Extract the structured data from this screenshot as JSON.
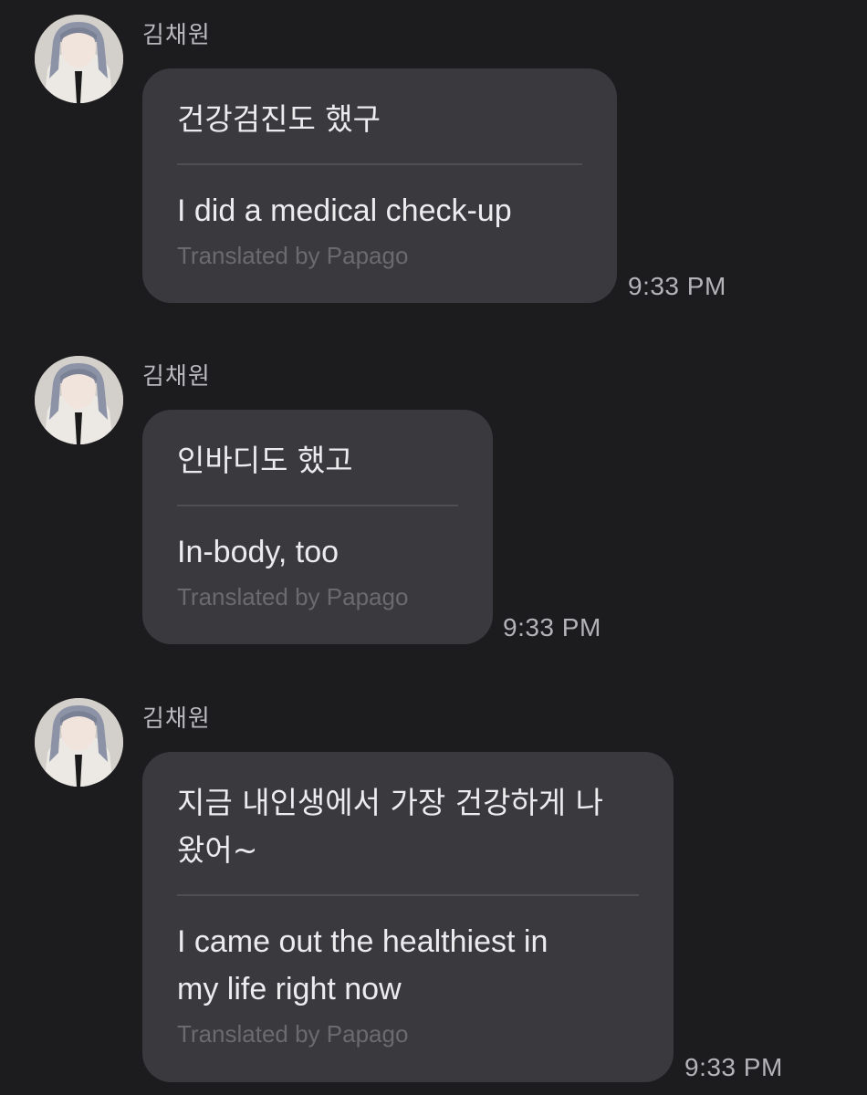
{
  "messages": [
    {
      "sender": "김채원",
      "original": "건강검진도 했구",
      "translation": "I did a medical check-up",
      "credit": "Translated by Papago",
      "time": "9:33 PM"
    },
    {
      "sender": "김채원",
      "original": "인바디도 했고",
      "translation": "In-body, too",
      "credit": "Translated by Papago",
      "time": "9:33 PM"
    },
    {
      "sender": "김채원",
      "original": "지금 내인생에서 가장 건강하게 나\n왔어~",
      "translation": "I came out the healthiest in\nmy life right now",
      "credit": "Translated by Papago",
      "time": "9:33 PM"
    }
  ],
  "colors": {
    "background": "#1c1c1e",
    "bubble": "#3a3a3e",
    "divider": "#4e4e53",
    "credit_text": "#6a6a70"
  }
}
